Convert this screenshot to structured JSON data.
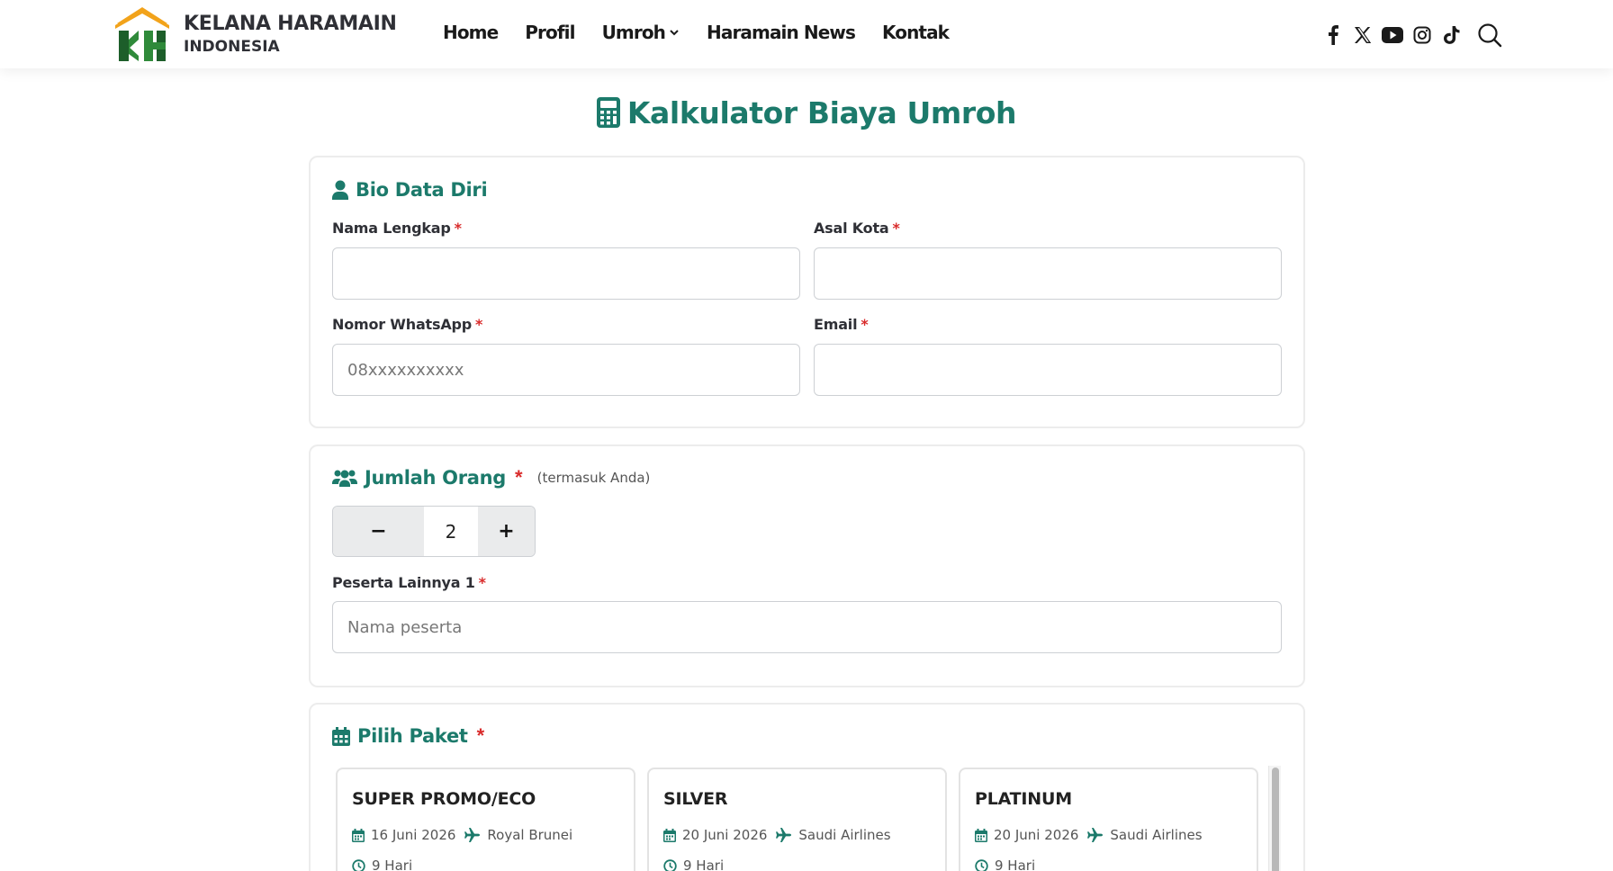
{
  "brand": {
    "name_line1": "KELANA HARAMAIN",
    "name_line2": "INDONESIA",
    "colors": {
      "orange": "#f2a31b",
      "green": "#2f8a3a",
      "dark_green": "#1d5e2a",
      "text": "#2f3036"
    }
  },
  "nav": {
    "items": [
      {
        "label": "Home"
      },
      {
        "label": "Profil"
      },
      {
        "label": "Umroh",
        "has_dropdown": true
      },
      {
        "label": "Haramain News"
      },
      {
        "label": "Kontak"
      }
    ]
  },
  "social": {
    "icons": [
      "facebook-icon",
      "x-icon",
      "youtube-icon",
      "instagram-icon",
      "tiktok-icon"
    ],
    "search_icon": "search-icon"
  },
  "page": {
    "title": "Kalkulator Biaya Umroh",
    "title_icon": "calculator-icon",
    "accent_color": "#1c7a6b",
    "required_color": "#d92b2b"
  },
  "bio": {
    "heading": "Bio Data Diri",
    "heading_icon": "user-icon",
    "fields": {
      "nama": {
        "label": "Nama Lengkap",
        "required": "*",
        "value": "",
        "placeholder": ""
      },
      "kota": {
        "label": "Asal Kota",
        "required": "*",
        "value": "",
        "placeholder": ""
      },
      "whatsapp": {
        "label": "Nomor WhatsApp",
        "required": "*",
        "value": "",
        "placeholder": "08xxxxxxxxxx"
      },
      "email": {
        "label": "Email",
        "required": "*",
        "value": "",
        "placeholder": ""
      }
    }
  },
  "jumlah": {
    "heading": "Jumlah Orang",
    "heading_icon": "users-icon",
    "required": "*",
    "note": "(termasuk Anda)",
    "minus_label": "−",
    "plus_label": "+",
    "value": "2",
    "peserta": {
      "label": "Peserta Lainnya 1",
      "required": "*",
      "placeholder": "Nama peserta"
    }
  },
  "paket": {
    "heading": "Pilih Paket",
    "heading_icon": "calendar-icon",
    "required": "*",
    "packages": [
      {
        "name": "SUPER PROMO/ECO",
        "date": "16 Juni 2026",
        "airline": "Royal Brunei",
        "duration": "9 Hari"
      },
      {
        "name": "SILVER",
        "date": "20 Juni 2026",
        "airline": "Saudi Airlines",
        "duration": "9 Hari"
      },
      {
        "name": "PLATINUM",
        "date": "20 Juni 2026",
        "airline": "Saudi Airlines",
        "duration": "9 Hari"
      }
    ]
  }
}
